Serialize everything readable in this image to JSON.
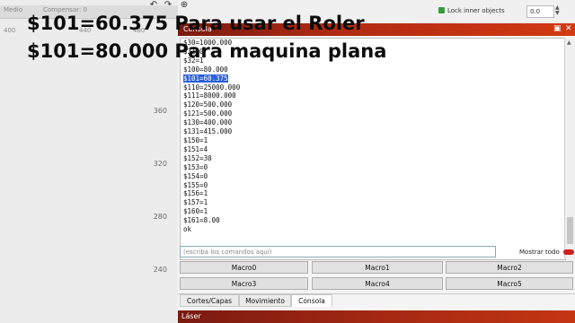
{
  "overlay": {
    "line1": "$101=60.375 Para usar el Roler",
    "line2": "$101=80.000 Para maquina plana"
  },
  "canvas": {
    "strip_left": "Medio",
    "strip_mid": "Compensar: 0",
    "top_ruler": [
      "400",
      "440",
      "480"
    ],
    "left_ruler": [
      "360",
      "320",
      "280",
      "240"
    ]
  },
  "toolbar": {
    "lock_label": "Lock inner objects",
    "spin_value": "0.0"
  },
  "console": {
    "title": "Consola",
    "lines": [
      "$30=1000.000",
      "$31=0",
      "$32=1",
      "$100=80.000",
      "$101=60.375",
      "$110=25000.000",
      "$111=8000.000",
      "$120=500.000",
      "$121=500.000",
      "$130=400.000",
      "$131=415.000",
      "$150=1",
      "$151=4",
      "$152=30",
      "$153=0",
      "$154=0",
      "$155=0",
      "$156=1",
      "$157=1",
      "$160=1",
      "$161=8.00",
      "ok"
    ],
    "selected_index": 4,
    "command_placeholder": "(escriba los comandos aquí)",
    "show_all_label": "Mostrar todo",
    "macros": [
      "Macro0",
      "Macro1",
      "Macro2",
      "Macro3",
      "Macro4",
      "Macro5"
    ]
  },
  "tabs": [
    "Cortes/Capas",
    "Movimiento",
    "Consola"
  ],
  "active_tab": "Consola",
  "laser_panel_title": "Láser"
}
